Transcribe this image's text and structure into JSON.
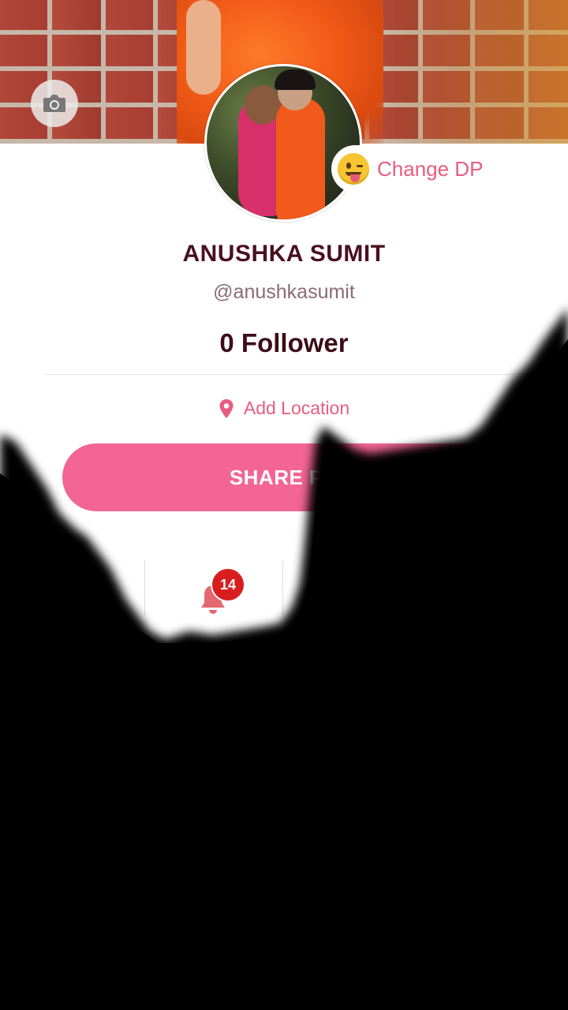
{
  "profile": {
    "name": "ANUSHKA SUMIT",
    "handle": "@anushkasumit",
    "followers_label": "0 Follower",
    "change_dp_label": "Change DP",
    "add_location_label": "Add Location",
    "share_button_label": "SHARE PR"
  },
  "tabs": {
    "notification_badge": "14"
  },
  "icons": {
    "camera": "camera-icon",
    "emoji": "tongue-out-emoji-icon",
    "location": "location-pin-icon",
    "bell": "bell-icon"
  },
  "colors": {
    "accent": "#f26595",
    "accent_text": "#e75c80",
    "name": "#4a1020",
    "badge": "#d81e1e"
  }
}
